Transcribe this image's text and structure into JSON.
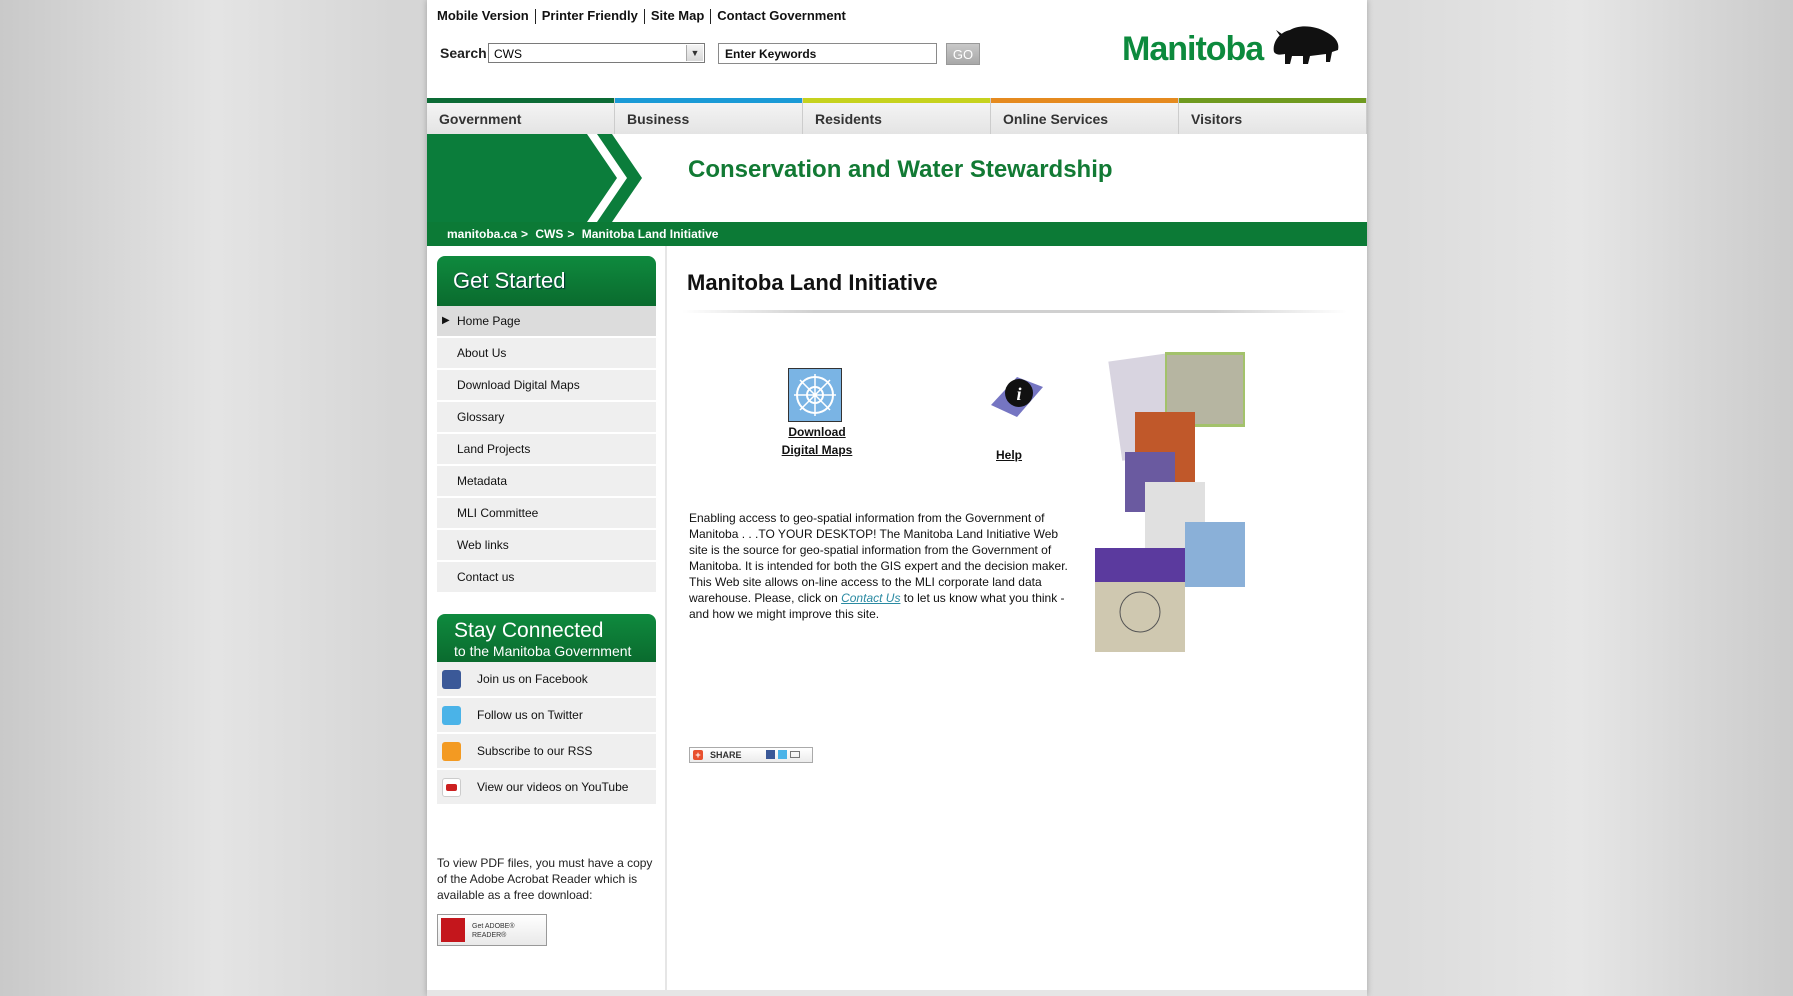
{
  "util_links": [
    "Mobile Version",
    "Printer Friendly",
    "Site Map",
    "Contact Government"
  ],
  "search": {
    "label": "Search",
    "scope_selected": "CWS",
    "keywords_value": "Enter Keywords",
    "go_label": "GO"
  },
  "logo": {
    "word": "Manitoba",
    "icon": "bison-icon"
  },
  "nav": [
    {
      "label": "Government",
      "color": "#0c6b35"
    },
    {
      "label": "Business",
      "color": "#1a9ad6"
    },
    {
      "label": "Residents",
      "color": "#c6d21e"
    },
    {
      "label": "Online Services",
      "color": "#e58a1f"
    },
    {
      "label": "Visitors",
      "color": "#6f9a1f"
    }
  ],
  "banner": {
    "title": "Conservation and Water Stewardship"
  },
  "breadcrumb": [
    "manitoba.ca",
    "CWS",
    "Manitoba Land Initiative"
  ],
  "sidebar": {
    "get_started_title": "Get Started",
    "menu": [
      "Home Page",
      "About Us",
      "Download Digital Maps",
      "Glossary",
      "Land Projects",
      "Metadata",
      "MLI Committee",
      "Web links",
      "Contact us"
    ],
    "stay_connected_title": "Stay Connected",
    "stay_connected_subtitle": "to the Manitoba Government",
    "social": [
      {
        "label": "Join us on Facebook",
        "icon": "facebook-icon",
        "color": "#3b5998"
      },
      {
        "label": "Follow us on Twitter",
        "icon": "twitter-icon",
        "color": "#4ab3e8"
      },
      {
        "label": "Subscribe to our RSS",
        "icon": "rss-icon",
        "color": "#f39a22"
      },
      {
        "label": "View our videos on YouTube",
        "icon": "youtube-icon",
        "color": "#cc2020"
      }
    ],
    "pdf_note": "To view PDF files, you must have a copy of the Adobe Acrobat Reader which is available as a free download:",
    "adobe_badge": "Get ADOBE® READER®"
  },
  "main": {
    "title": "Manitoba Land Initiative",
    "download_label_line1": "Download",
    "download_label_line2": "Digital Maps",
    "help_label": "Help",
    "intro_before": "Enabling access to geo-spatial information from the Government of Manitoba . . .TO YOUR DESKTOP! The Manitoba Land Initiative Web site is the source for geo-spatial information from the Government of Manitoba. It is intended for both the GIS expert and the decision maker. This Web site allows on-line access to the MLI corporate land data warehouse. Please, click on ",
    "intro_link": "Contact Us",
    "intro_after": " to let us know what you think - and how we might improve this site.",
    "share_label": "SHARE"
  }
}
